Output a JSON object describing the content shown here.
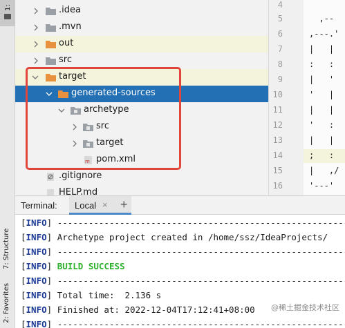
{
  "sidebar_strip": {
    "top_label": "1:",
    "structure_label": "7: Structure",
    "favorites_label": "2: Favorites"
  },
  "project_tree": {
    "rows": [
      {
        "label": ".idea",
        "icon": "folder-gray-icon",
        "expanded": false
      },
      {
        "label": ".mvn",
        "icon": "folder-gray-icon",
        "expanded": false
      },
      {
        "label": "out",
        "icon": "folder-orange-icon",
        "expanded": false
      },
      {
        "label": "src",
        "icon": "folder-gray-icon",
        "expanded": false
      },
      {
        "label": "target",
        "icon": "folder-orange-icon",
        "expanded": true
      },
      {
        "label": "generated-sources",
        "icon": "folder-orange-icon",
        "expanded": true,
        "selected": true
      },
      {
        "label": "archetype",
        "icon": "folder-package-icon",
        "expanded": true
      },
      {
        "label": "src",
        "icon": "folder-package-icon",
        "expanded": false
      },
      {
        "label": "target",
        "icon": "folder-package-icon",
        "expanded": false
      },
      {
        "label": "pom.xml",
        "icon": "maven-file-icon",
        "expanded": null
      },
      {
        "label": ".gitignore",
        "icon": "gitignore-file-icon",
        "expanded": null
      },
      {
        "label": "HELP.md",
        "icon": "markdown-file-icon",
        "expanded": null
      }
    ]
  },
  "editor": {
    "line_numbers": [
      "4",
      "5",
      "6",
      "7",
      "8",
      "9",
      "10",
      "11",
      "12",
      "13",
      "14",
      "15",
      "16"
    ],
    "code_lines": [
      "",
      "  ,--",
      ",---.'",
      "|   |",
      ":   :",
      "|   '",
      "'   |",
      "|   |",
      "'   :",
      "|   |",
      ";   :",
      "|   ,/",
      "'---'"
    ],
    "highlighted_line": "14"
  },
  "terminal": {
    "title": "Terminal:",
    "tab_label": "Local",
    "tab_close": "×",
    "new_tab": "+",
    "tag": "INFO",
    "lines": [
      {
        "text": " ------------------------------------------------------------------------",
        "kind": "plain"
      },
      {
        "text": " Archetype project created in /home/ssz/IdeaProjects/",
        "kind": "plain"
      },
      {
        "text": " ------------------------------------------------------------------------",
        "kind": "plain"
      },
      {
        "text": " BUILD SUCCESS",
        "kind": "success"
      },
      {
        "text": " ------------------------------------------------------------------------",
        "kind": "plain"
      },
      {
        "text": " Total time:  2.136 s",
        "kind": "plain"
      },
      {
        "text": " Finished at: 2022-12-04T17:12:41+08:00",
        "kind": "plain"
      },
      {
        "text": " ------------------------------------------------------------------------",
        "kind": "plain"
      }
    ]
  },
  "watermark": "@稀土掘金技术社区",
  "colors": {
    "selection": "#2470b4",
    "annotation": "#e0463c",
    "success": "#2bb12b",
    "info_tag": "#1c3a96"
  }
}
